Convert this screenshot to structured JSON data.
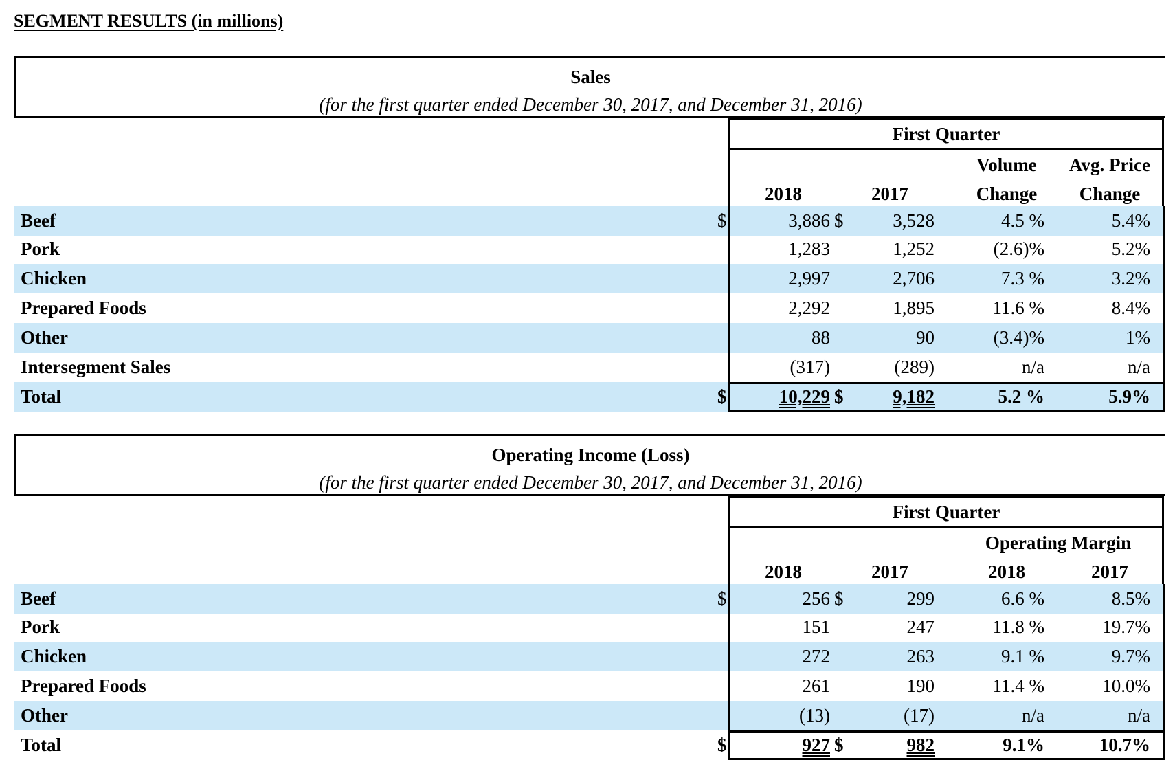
{
  "page_title": "SEGMENT RESULTS (in millions)",
  "sales": {
    "title": "Sales",
    "subtitle": "(for the first quarter ended December 30, 2017, and December 31, 2016)",
    "group_header": "First Quarter",
    "columns": [
      "2018",
      "2017",
      "Volume Change",
      "Avg. Price Change"
    ],
    "col_line1": [
      "",
      "",
      "Volume",
      "Avg. Price"
    ],
    "col_line2": [
      "2018",
      "2017",
      "Change",
      "Change"
    ],
    "rows": [
      {
        "label": "Beef",
        "d1": "$",
        "v2018": "3,886",
        "d2": "$",
        "v2017": "3,528",
        "c3": "4.5 %",
        "c4": "5.4%"
      },
      {
        "label": "Pork",
        "d1": "",
        "v2018": "1,283",
        "d2": "",
        "v2017": "1,252",
        "c3": "(2.6)%",
        "c4": "5.2%"
      },
      {
        "label": "Chicken",
        "d1": "",
        "v2018": "2,997",
        "d2": "",
        "v2017": "2,706",
        "c3": "7.3 %",
        "c4": "3.2%"
      },
      {
        "label": "Prepared Foods",
        "d1": "",
        "v2018": "2,292",
        "d2": "",
        "v2017": "1,895",
        "c3": "11.6 %",
        "c4": "8.4%"
      },
      {
        "label": "Other",
        "d1": "",
        "v2018": "88",
        "d2": "",
        "v2017": "90",
        "c3": "(3.4)%",
        "c4": "1%"
      },
      {
        "label": "Intersegment Sales",
        "d1": "",
        "v2018": "(317)",
        "d2": "",
        "v2017": "(289)",
        "c3": "n/a",
        "c4": "n/a"
      },
      {
        "label": "Total",
        "d1": "$",
        "v2018": "10,229",
        "d2": "$",
        "v2017": "9,182",
        "c3": "5.2 %",
        "c4": "5.9%"
      }
    ]
  },
  "operating": {
    "title": "Operating Income (Loss)",
    "subtitle": "(for the first quarter ended December 30, 2017, and December 31, 2016)",
    "group_header": "First Quarter",
    "sub_header": "Operating Margin",
    "col_line2": [
      "2018",
      "2017",
      "2018",
      "2017"
    ],
    "rows": [
      {
        "label": "Beef",
        "d1": "$",
        "v2018": "256",
        "d2": "$",
        "v2017": "299",
        "c3": "6.6 %",
        "c4": "8.5%"
      },
      {
        "label": "Pork",
        "d1": "",
        "v2018": "151",
        "d2": "",
        "v2017": "247",
        "c3": "11.8 %",
        "c4": "19.7%"
      },
      {
        "label": "Chicken",
        "d1": "",
        "v2018": "272",
        "d2": "",
        "v2017": "263",
        "c3": "9.1 %",
        "c4": "9.7%"
      },
      {
        "label": "Prepared Foods",
        "d1": "",
        "v2018": "261",
        "d2": "",
        "v2017": "190",
        "c3": "11.4 %",
        "c4": "10.0%"
      },
      {
        "label": "Other",
        "d1": "",
        "v2018": "(13)",
        "d2": "",
        "v2017": "(17)",
        "c3": "n/a",
        "c4": "n/a"
      },
      {
        "label": "Total",
        "d1": "$",
        "v2018": "927",
        "d2": "$",
        "v2017": "982",
        "c3": "9.1%",
        "c4": "10.7%"
      }
    ]
  }
}
